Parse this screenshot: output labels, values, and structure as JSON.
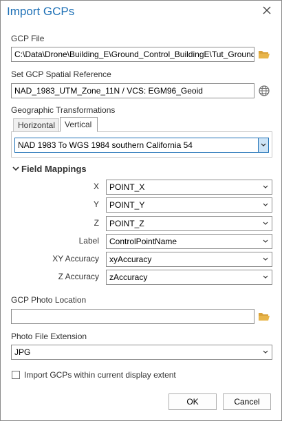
{
  "title": "Import GCPs",
  "gcp_file": {
    "label": "GCP File",
    "value": "C:\\Data\\Drone\\Building_E\\Ground_Control_BuildingE\\Tut_Ground"
  },
  "spatial_ref": {
    "label": "Set GCP Spatial Reference",
    "value": "NAD_1983_UTM_Zone_11N / VCS: EGM96_Geoid"
  },
  "transforms": {
    "label": "Geographic Transformations",
    "tabs": [
      "Horizontal",
      "Vertical"
    ],
    "active_tab": "Vertical",
    "selected": "NAD 1983 To WGS 1984 southern California 54"
  },
  "field_mappings": {
    "label": "Field Mappings",
    "rows": [
      {
        "label": "X",
        "value": "POINT_X"
      },
      {
        "label": "Y",
        "value": "POINT_Y"
      },
      {
        "label": "Z",
        "value": "POINT_Z"
      },
      {
        "label": "Label",
        "value": "ControlPointName"
      },
      {
        "label": "XY Accuracy",
        "value": "xyAccuracy"
      },
      {
        "label": "Z Accuracy",
        "value": "zAccuracy"
      }
    ]
  },
  "photo_location": {
    "label": "GCP Photo Location",
    "value": ""
  },
  "photo_ext": {
    "label": "Photo File Extension",
    "value": "JPG"
  },
  "extent_checkbox": {
    "label": "Import GCPs within current display extent",
    "checked": false
  },
  "buttons": {
    "ok": "OK",
    "cancel": "Cancel"
  },
  "colors": {
    "title": "#1c6fb5",
    "folder": "#e8b54a",
    "accent": "#1c6fb5"
  },
  "icons": {
    "close": "close-icon",
    "folder": "folder-icon",
    "globe": "globe-icon",
    "chevron": "chevron-down-icon"
  }
}
